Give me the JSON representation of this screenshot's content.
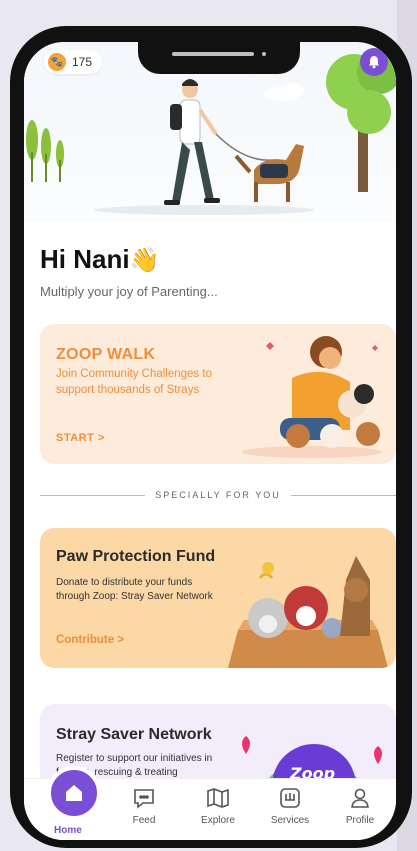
{
  "status": {
    "coins": "175"
  },
  "greeting": {
    "name": "Hi Nani",
    "subtitle": "Multiply your joy of Parenting..."
  },
  "walk_card": {
    "title": "ZOOP WALK",
    "desc": "Join Community Challenges to support thousands of Strays",
    "cta": "START >"
  },
  "section": {
    "label": "SPECIALLY FOR YOU"
  },
  "paw_card": {
    "title": "Paw Protection Fund",
    "desc": "Donate to distribute your funds through Zoop: Stray Saver Network",
    "cta": "Contribute >"
  },
  "stray_card": {
    "title": "Stray Saver Network",
    "desc": "Register to support our initiatives in feeding, rescuing & treating",
    "badge": "Zoop"
  },
  "nav": {
    "home": "Home",
    "feed": "Feed",
    "explore": "Explore",
    "services": "Services",
    "profile": "Profile"
  },
  "colors": {
    "accent": "#7a4fd6",
    "orange": "#f18d3a"
  }
}
